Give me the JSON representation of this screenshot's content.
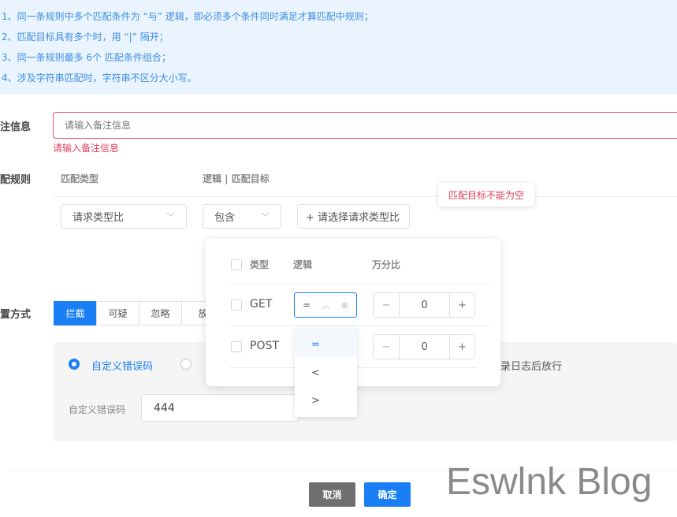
{
  "tips": [
    "1、同一条规则中多个匹配条件为 “与” 逻辑，即必须多个条件同时满足才算匹配中规则；",
    "2、匹配目标具有多个时，用 “|” 隔开；",
    "3、同一条规则最多 6个 匹配条件组合；",
    "4、涉及字符串匹配时，字符串不区分大小写。"
  ],
  "remark": {
    "label": "注信息",
    "placeholder": "请输入备注信息",
    "error": "请输入备注信息"
  },
  "rules": {
    "label": "配规则",
    "col_type": "匹配类型",
    "col_logic": "逻辑 | 匹配目标",
    "type_value": "请求类型比",
    "logic_value": "包含",
    "add_target": "+ 请选择请求类型比",
    "tooltip": "匹配目标不能为空"
  },
  "popup": {
    "headers": {
      "type": "类型",
      "logic": "逻辑",
      "ratio": "万分比"
    },
    "rows": [
      {
        "type": "GET",
        "logic": "=",
        "value": "0"
      },
      {
        "type": "POST",
        "value": "0"
      }
    ],
    "options": [
      "=",
      "<",
      ">"
    ]
  },
  "action": {
    "label": "置方式",
    "segments": [
      "拦截",
      "可疑",
      "忽略",
      "放"
    ],
    "radios": [
      "自定义错误码",
      "",
      "记录日志后放行"
    ],
    "code_label": "自定义错误码",
    "code_value": "444"
  },
  "footer": {
    "cancel": "取消",
    "confirm": "确定"
  },
  "watermark": "Eswlnk Blog"
}
